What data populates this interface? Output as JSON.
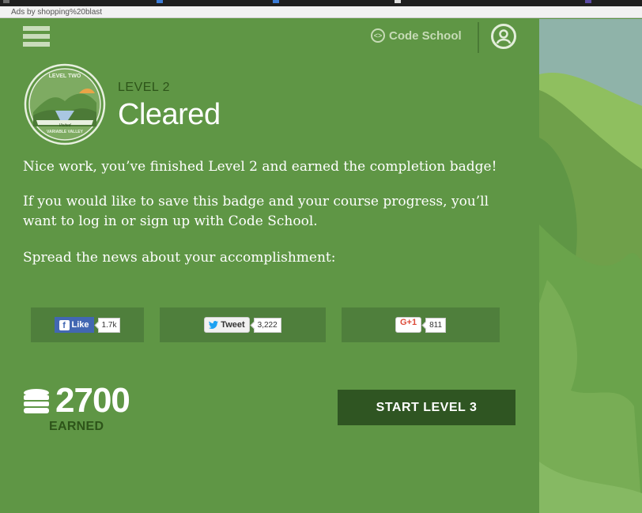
{
  "ads_bar": {
    "text": "Ads by shopping%20blast"
  },
  "header": {
    "menu_icon": "hamburger-icon",
    "logo_text": "Code School",
    "logo_icon": "code-brackets-icon",
    "user_icon": "user-icon"
  },
  "level": {
    "badge_top_text": "LEVEL TWO",
    "badge_bottom_text": "VARIABLE VALLEY",
    "badge_script_text": "Visited",
    "label": "LEVEL 2",
    "status": "Cleared"
  },
  "messages": {
    "line1": "Nice work, you’ve finished Level 2 and earned the completion badge!",
    "line2": "If you would like to save this badge and your course progress, you’ll want to log in or sign up with Code School.",
    "line3": "Spread the news about your accomplishment:"
  },
  "share": {
    "facebook": {
      "label": "Like",
      "count": "1.7k",
      "icon": "facebook-icon"
    },
    "twitter": {
      "label": "Tweet",
      "count": "3,222",
      "icon": "twitter-bird-icon"
    },
    "google": {
      "label": "G+1",
      "count": "811"
    }
  },
  "score": {
    "points": "2700",
    "earned_label": "EARNED",
    "icon": "coin-stack-icon"
  },
  "actions": {
    "start_next": "START LEVEL 3"
  },
  "colors": {
    "panel_bg": "#5f9645",
    "share_bg": "#4f7f3c",
    "button_bg": "#2f5522",
    "dark_text": "#2d5419"
  }
}
